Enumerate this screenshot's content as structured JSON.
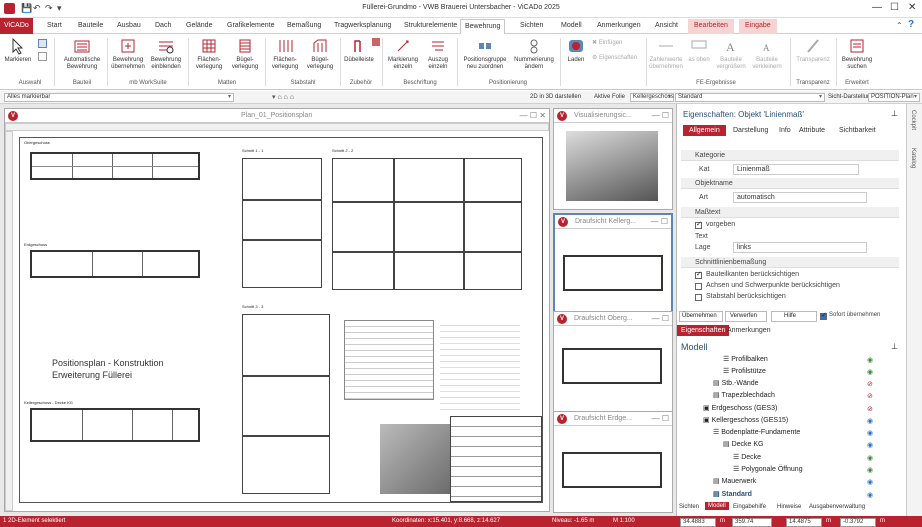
{
  "app": {
    "title": "Füllerei-Grundmo - VWB Brauerei Untersbacher - ViCADo 2025",
    "quick_access": [
      "💾",
      "↶",
      "↷",
      "▾"
    ],
    "window_controls": [
      "—",
      "☐",
      "✕"
    ]
  },
  "ribbon": {
    "tabs": [
      "ViCADo",
      "Start",
      "Bauteile",
      "Ausbau",
      "Dach",
      "Gelände",
      "Grafikelemente",
      "Bemaßung",
      "Tragwerksplanung",
      "Strukturelemente",
      "Bewehrung",
      "Sichten",
      "Modell",
      "Anmerkungen",
      "Ansicht",
      "Bearbeiten",
      "Eingabe"
    ],
    "active_tab": "Bewehrung",
    "buttons": {
      "markieren": "Markieren",
      "auto_bew": "Automatische Bewehrung",
      "bew_uebernehmen": "Bewehrung übernehmen",
      "bew_einblenden": "Bewehrung einblenden",
      "flaechen": "Flächen-verlegung",
      "buegel": "Bügel-verlegung",
      "flaechen2": "Flächen-verlegung",
      "buegel2": "Bügel-verlegung",
      "duebelleiste": "Dübelleiste",
      "markierung": "Markierung einzeln",
      "auszug": "Auszug einzeln",
      "posgruppe": "Positionsgruppe neu zuordnen",
      "nummerierung": "Nummerierung ändern",
      "laden": "Laden",
      "einfuegen": "Einfügen",
      "eigenschaften": "Eigenschaften",
      "zahlenwerte": "Zahlenwerte übernehmen",
      "as": "as oben",
      "bauteile_vergr": "Bauteile vergrößern",
      "bauteile_verk": "Bauteile verkleinern",
      "transparenz": "Transparenz",
      "bew_suchen": "Bewehrung suchen"
    },
    "groups": [
      "Auswahl",
      "Bauteil",
      "mb WorkSuite",
      "Matten",
      "Stabstahl",
      "Zubehör",
      "Beschriftung",
      "Positionierung",
      "FE-Ergebnisse",
      "Transparenz",
      "Erweitert"
    ]
  },
  "toolbar2": {
    "filter": "Alles markierbar",
    "d2in3d": "2D in 3D darstellen",
    "aktive_folie": "Aktive Folie",
    "folie_value": "Kellergeschoss",
    "standard": "Standard",
    "sicht_label": "Sicht-Darstellung",
    "sicht_value": "POSITION-Plan"
  },
  "windows": {
    "main": {
      "title": "Plan_01_Positionsplan",
      "plan_title": "Positionsplan - Konstruktion",
      "plan_subtitle": "Erweiterung Füllerei",
      "sec1": "Schnitt 1 - 1",
      "sec2": "Schnitt 2 - 2",
      "sec3": "Schnitt 3 - 3",
      "g1": "Obergeschoss",
      "g2": "Erdgeschoss",
      "g3": "Kellergeschoss - Decke KG"
    },
    "w2": {
      "title": "Visualisierungsic..."
    },
    "w3": {
      "title": "Draufsicht Kellerg..."
    },
    "w4": {
      "title": "Draufsicht Oberg..."
    },
    "w5": {
      "title": "Draufsicht Erdge..."
    }
  },
  "properties": {
    "title": "Eigenschaften: Objekt 'Linienmaß'",
    "tabs": [
      "Allgemein",
      "Darstellung",
      "Info",
      "Attribute",
      "Sichtbarkeit"
    ],
    "sections": {
      "kategorie": "Kategorie",
      "objektname": "Objektname",
      "masstext": "Maßtext",
      "schnittlinie": "Schnittlinienbemaßung"
    },
    "fields": {
      "kat_label": "Kat",
      "kat_value": "Linienmaß",
      "art_label": "Art",
      "art_value": "automatisch",
      "vorgeben": "vorgeben",
      "text_label": "Text",
      "lage_label": "Lage",
      "lage_value": "links"
    },
    "checks": {
      "c1": "Bauteilkanten berücksichtigen",
      "c2": "Achsen und Schwerpunkte berücksichtigen",
      "c3": "Stabstahl berücksichtigen"
    },
    "buttons": {
      "uebernehmen": "Übernehmen",
      "verwerfen": "Verwerfen",
      "hilfe": "Hilfe",
      "sofort": "Sofort übernehmen"
    }
  },
  "model": {
    "tabs": [
      "Eigenschaften",
      "Anmerkungen"
    ],
    "heading": "Modell",
    "items": [
      "Profilbalken",
      "Profilstütze",
      "Stb.-Wände",
      "Trapezblechdach",
      "Erdgeschoss (GES3)",
      "Kellergeschoss (GES15)",
      "Bodenplatte-Fundamente",
      "Decke KG",
      "Decke",
      "Polygonale Öffnung",
      "Mauerwerk",
      "Standard"
    ],
    "bottom_tabs": [
      "Sichten",
      "Modell",
      "Eingabehilfe",
      "Hinweise",
      "Ausgabenverwaltung"
    ]
  },
  "sidebar": {
    "tabs": [
      "Cockpit",
      "Katalog"
    ]
  },
  "statusbar": {
    "msg": "1 2D-Element selektiert",
    "coords": "Koordinaten: x:15.401, y:8.668, z:14.627",
    "niveau": "Niveau: -1.65 m",
    "scale": "M 1:100",
    "f1": "34.4883",
    "u1": "m",
    "f2": "359.74",
    "f3": "14.4875",
    "u3": "m",
    "f4": "-0.3792",
    "u4": "m"
  }
}
